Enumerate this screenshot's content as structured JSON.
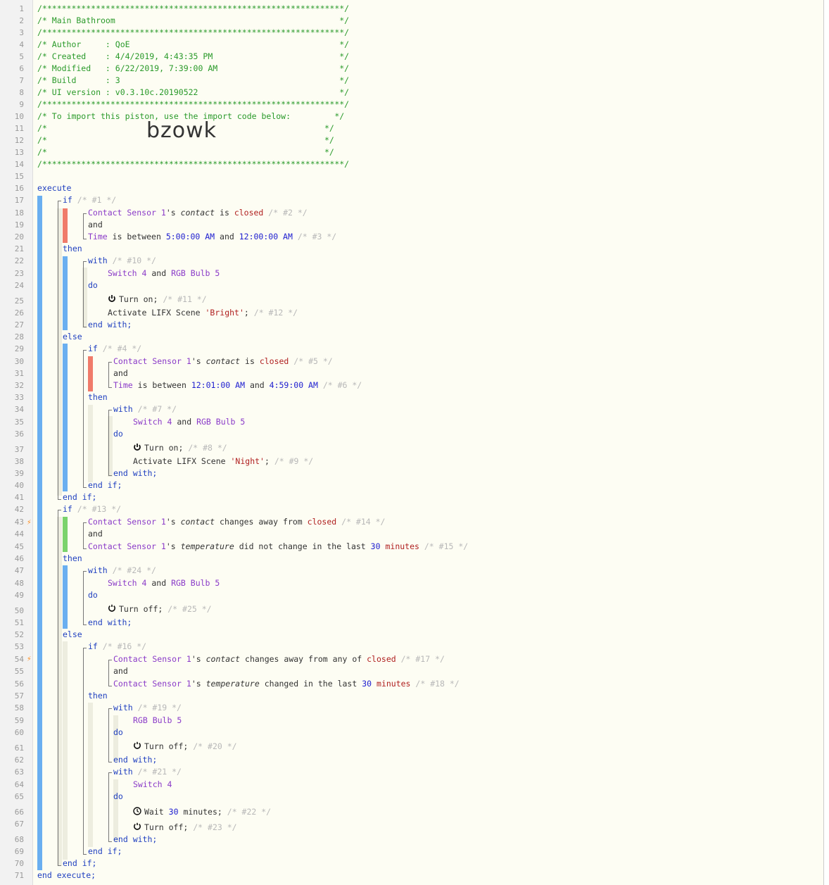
{
  "line_numbers": [
    "1",
    "2",
    "3",
    "4",
    "5",
    "6",
    "7",
    "8",
    "9",
    "10",
    "11",
    "12",
    "13",
    "14",
    "15",
    "16",
    "17",
    "18",
    "19",
    "20",
    "21",
    "22",
    "23",
    "24",
    "25",
    "26",
    "27",
    "28",
    "29",
    "30",
    "31",
    "32",
    "33",
    "34",
    "35",
    "36",
    "37",
    "38",
    "39",
    "40",
    "41",
    "42",
    "43",
    "44",
    "45",
    "46",
    "47",
    "48",
    "49",
    "50",
    "51",
    "52",
    "53",
    "54",
    "55",
    "56",
    "57",
    "58",
    "59",
    "60",
    "61",
    "62",
    "63",
    "64",
    "65",
    "66",
    "67",
    "68",
    "69",
    "70",
    "71"
  ],
  "header": {
    "l1": "/**************************************************************/",
    "l2": "/* Main Bathroom                                              */",
    "l3": "/**************************************************************/",
    "l4": "/* Author     : QoE                                           */",
    "l5": "/* Created    : 4/4/2019, 4:43:35 PM                          */",
    "l6": "/* Modified   : 6/22/2019, 7:39:00 AM                         */",
    "l7": "/* Build      : 3                                             */",
    "l8": "/* UI version : v0.3.10c.20190522                             */",
    "l9": "/**************************************************************/",
    "l10": "/* To import this piston, use the import code below:         */",
    "l11a": "/*",
    "l11b": "*/",
    "l12a": "/*",
    "l12b": "*/",
    "l13a": "/*",
    "l13b": "*/",
    "l14": "/**************************************************************/",
    "import_code": "bzowk"
  },
  "kw": {
    "execute": "execute",
    "end_execute": "end execute;",
    "if": "if",
    "then": "then",
    "else": "else",
    "and": "and",
    "with": "with",
    "do": "do",
    "end_with": "end with;",
    "end_if": "end if;"
  },
  "devs": {
    "contact_sensor": "Contact Sensor",
    "one": "1",
    "switch": "Switch",
    "four": "4",
    "rgb_bulb": "RGB Bulb",
    "five": "5",
    "time": "Time"
  },
  "words": {
    "s": "'s",
    "contact": "contact",
    "is": "is",
    "closed": "closed",
    "is_between": "is between",
    "and": "and",
    "temperature": "temperature",
    "changes_away_from": "changes away from",
    "changes_away_from_any_of": "changes away from any of",
    "did_not_change": "did not change in the last",
    "changed_in_last": "changed in the last",
    "minutes": "minutes",
    "thirty": "30",
    "turn_on": "Turn on;",
    "turn_off": "Turn off;",
    "activate": "Activate LIFX Scene",
    "wait": "Wait",
    "wait_minutes": "minutes;",
    "bright": "'Bright'",
    "night": "'Night'",
    "semi": ";",
    "t1a": "5:00:00 AM",
    "t1b": "12:00:00 AM",
    "t2a": "12:01:00 AM",
    "t2b": "4:59:00 AM"
  },
  "ids": {
    "c1": "/* #1 */",
    "c2": "/* #2 */",
    "c3": "/* #3 */",
    "c4": "/* #4 */",
    "c5": "/* #5 */",
    "c6": "/* #6 */",
    "c7": "/* #7 */",
    "c8": "/* #8 */",
    "c9": "/* #9 */",
    "c10": "/* #10 */",
    "c11": "/* #11 */",
    "c12": "/* #12 */",
    "c13": "/* #13 */",
    "c14": "/* #14 */",
    "c15": "/* #15 */",
    "c16": "/* #16 */",
    "c17": "/* #17 */",
    "c18": "/* #18 */",
    "c19": "/* #19 */",
    "c20": "/* #20 */",
    "c21": "/* #21 */",
    "c22": "/* #22 */",
    "c23": "/* #23 */",
    "c24": "/* #24 */",
    "c25": "/* #25 */"
  },
  "icons": {
    "power_on": "power-on-icon",
    "power_off": "power-off-icon",
    "clock": "clock-icon",
    "trigger": "lightning-bolt-icon"
  },
  "colors": {
    "comment": "#2a9a2a",
    "keyword": "#2040c0",
    "device": "#8a3ac8",
    "string": "#b02020",
    "bar_blue": "#6aaff0",
    "bar_red": "#f07b6a",
    "bar_green": "#7bd36c"
  }
}
